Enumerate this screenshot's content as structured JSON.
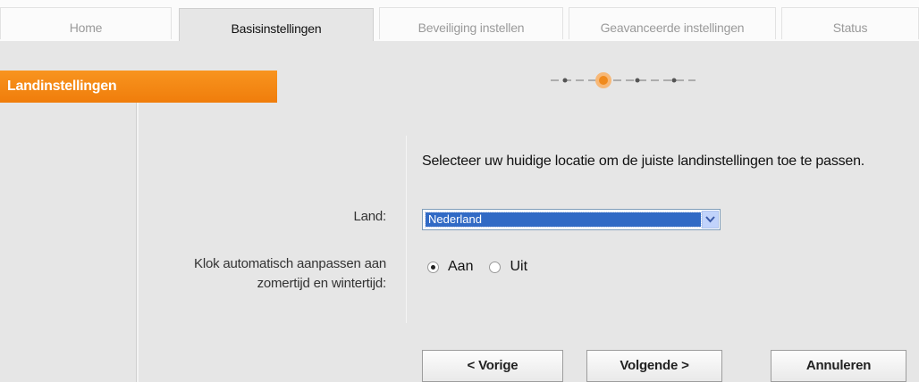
{
  "tabs": [
    {
      "label": "Home"
    },
    {
      "label": "Basisinstellingen"
    },
    {
      "label": "Beveiliging instellen"
    },
    {
      "label": "Geavanceerde instellingen"
    },
    {
      "label": "Status"
    }
  ],
  "active_tab": "Basisinstellingen",
  "sidebar": {
    "title": "Landinstellingen"
  },
  "wizard": {
    "step_count": 5,
    "current_step": 2,
    "accent": "#f39019"
  },
  "content": {
    "intro": "Selecteer uw huidige locatie om de juiste landinstellingen toe te passen.",
    "land": {
      "label": "Land:",
      "value": "Nederland"
    },
    "klok": {
      "label": "Klok automatisch aanpassen aan zomertijd en wintertijd:",
      "options": [
        {
          "label": "Aan",
          "selected": true
        },
        {
          "label": "Uit",
          "selected": false
        }
      ]
    }
  },
  "buttons": {
    "prev": "< Vorige",
    "next": "Volgende >",
    "cancel": "Annuleren"
  }
}
